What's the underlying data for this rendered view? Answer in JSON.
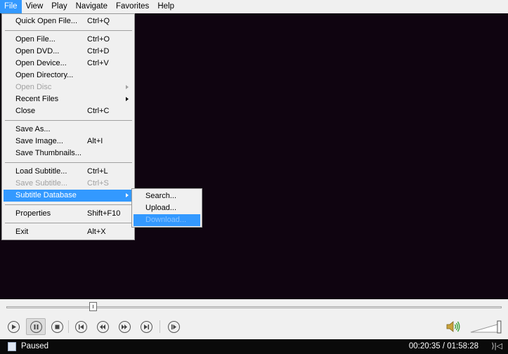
{
  "menubar": {
    "items": [
      "File",
      "View",
      "Play",
      "Navigate",
      "Favorites",
      "Help"
    ],
    "active": "File"
  },
  "file_menu": {
    "groups": [
      [
        {
          "label": "Quick Open File...",
          "shortcut": "Ctrl+Q",
          "state": "enabled"
        }
      ],
      [
        {
          "label": "Open File...",
          "shortcut": "Ctrl+O",
          "state": "enabled"
        },
        {
          "label": "Open DVD...",
          "shortcut": "Ctrl+D",
          "state": "enabled"
        },
        {
          "label": "Open Device...",
          "shortcut": "Ctrl+V",
          "state": "enabled"
        },
        {
          "label": "Open Directory...",
          "shortcut": "",
          "state": "enabled"
        },
        {
          "label": "Open Disc",
          "shortcut": "",
          "state": "disabled",
          "submenu": true
        },
        {
          "label": "Recent Files",
          "shortcut": "",
          "state": "enabled",
          "submenu": true
        },
        {
          "label": "Close",
          "shortcut": "Ctrl+C",
          "state": "enabled"
        }
      ],
      [
        {
          "label": "Save As...",
          "shortcut": "",
          "state": "enabled"
        },
        {
          "label": "Save Image...",
          "shortcut": "Alt+I",
          "state": "enabled"
        },
        {
          "label": "Save Thumbnails...",
          "shortcut": "",
          "state": "enabled"
        }
      ],
      [
        {
          "label": "Load Subtitle...",
          "shortcut": "Ctrl+L",
          "state": "enabled"
        },
        {
          "label": "Save Subtitle...",
          "shortcut": "Ctrl+S",
          "state": "disabled"
        },
        {
          "label": "Subtitle Database",
          "shortcut": "",
          "state": "highlighted",
          "submenu": true
        }
      ],
      [
        {
          "label": "Properties",
          "shortcut": "Shift+F10",
          "state": "enabled"
        }
      ],
      [
        {
          "label": "Exit",
          "shortcut": "Alt+X",
          "state": "enabled"
        }
      ]
    ]
  },
  "subtitle_db_menu": {
    "items": [
      {
        "label": "Search...",
        "state": "enabled"
      },
      {
        "label": "Upload...",
        "state": "enabled"
      },
      {
        "label": "Download...",
        "state": "highlighted-disabled"
      }
    ]
  },
  "player": {
    "seek_position_fraction": 0.175,
    "volume_fraction": 0.95,
    "controls": [
      "play-icon",
      "pause-icon",
      "stop-icon",
      "skip-back-icon",
      "rewind-icon",
      "fast-forward-icon",
      "skip-forward-icon",
      "frame-step-icon"
    ],
    "pressed": "pause-icon"
  },
  "status": {
    "text": "Paused",
    "time": "00:20:35 / 01:58:28"
  },
  "colors": {
    "video_bg": "#0f0410",
    "highlight": "#3399ff",
    "status_bg": "#0a0a0a"
  }
}
